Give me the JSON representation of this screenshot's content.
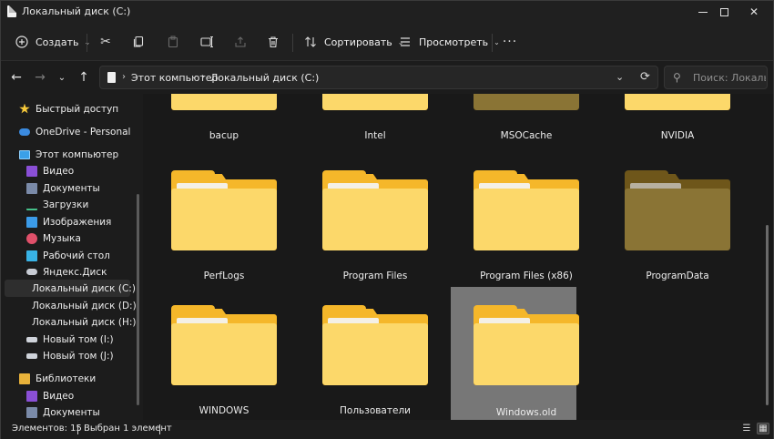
{
  "window": {
    "title": "Локальный диск (C:)"
  },
  "toolbar": {
    "new_label": "Создать",
    "sort_label": "Сортировать",
    "view_label": "Просмотреть",
    "more_glyph": "···"
  },
  "address": {
    "crumbs": [
      "Этот компьютер",
      "Локальный диск (C:)"
    ],
    "search_placeholder": "Поиск: Локальны..."
  },
  "sidebar": {
    "items": [
      {
        "label": "Быстрый доступ",
        "icon": "star-icon"
      },
      {
        "label": "OneDrive - Personal",
        "icon": "cloud-icon"
      },
      {
        "label": "Этот компьютер",
        "icon": "monitor-icon"
      },
      {
        "label": "Видео",
        "icon": "video-icon"
      },
      {
        "label": "Документы",
        "icon": "documents-icon"
      },
      {
        "label": "Загрузки",
        "icon": "download-icon"
      },
      {
        "label": "Изображения",
        "icon": "pictures-icon"
      },
      {
        "label": "Музыка",
        "icon": "music-icon"
      },
      {
        "label": "Рабочий стол",
        "icon": "desktop-icon"
      },
      {
        "label": "Яндекс.Диск",
        "icon": "yandex-disk-icon"
      },
      {
        "label": "Локальный диск (C:)",
        "icon": "drive-icon"
      },
      {
        "label": "Локальный диск (D:)",
        "icon": "drive-icon"
      },
      {
        "label": "Локальный диск (H:)",
        "icon": "drive-icon"
      },
      {
        "label": "Новый том (I:)",
        "icon": "drive-icon"
      },
      {
        "label": "Новый том (J:)",
        "icon": "drive-icon"
      },
      {
        "label": "Библиотеки",
        "icon": "library-icon"
      },
      {
        "label": "Видео",
        "icon": "video-icon"
      },
      {
        "label": "Документы",
        "icon": "documents-icon"
      }
    ],
    "selected_label": "Локальный диск (C:)"
  },
  "folders": [
    {
      "name": "bacup"
    },
    {
      "name": "Intel"
    },
    {
      "name": "MSOCache",
      "hidden": true
    },
    {
      "name": "NVIDIA"
    },
    {
      "name": "PerfLogs"
    },
    {
      "name": "Program Files"
    },
    {
      "name": "Program Files (x86)"
    },
    {
      "name": "ProgramData",
      "hidden": true
    },
    {
      "name": "WINDOWS"
    },
    {
      "name": "Пользователи"
    },
    {
      "name": "Windows.old",
      "selected": true
    }
  ],
  "status": {
    "count": "Элементов: 15",
    "selection": "Выбран 1 элемент"
  },
  "colors": {
    "folder_front": "#fcd86a",
    "folder_back": "#f5b72a",
    "folder_hidden_front": "#8a7435",
    "folder_hidden_back": "#6e561a",
    "selection": "#777777"
  }
}
